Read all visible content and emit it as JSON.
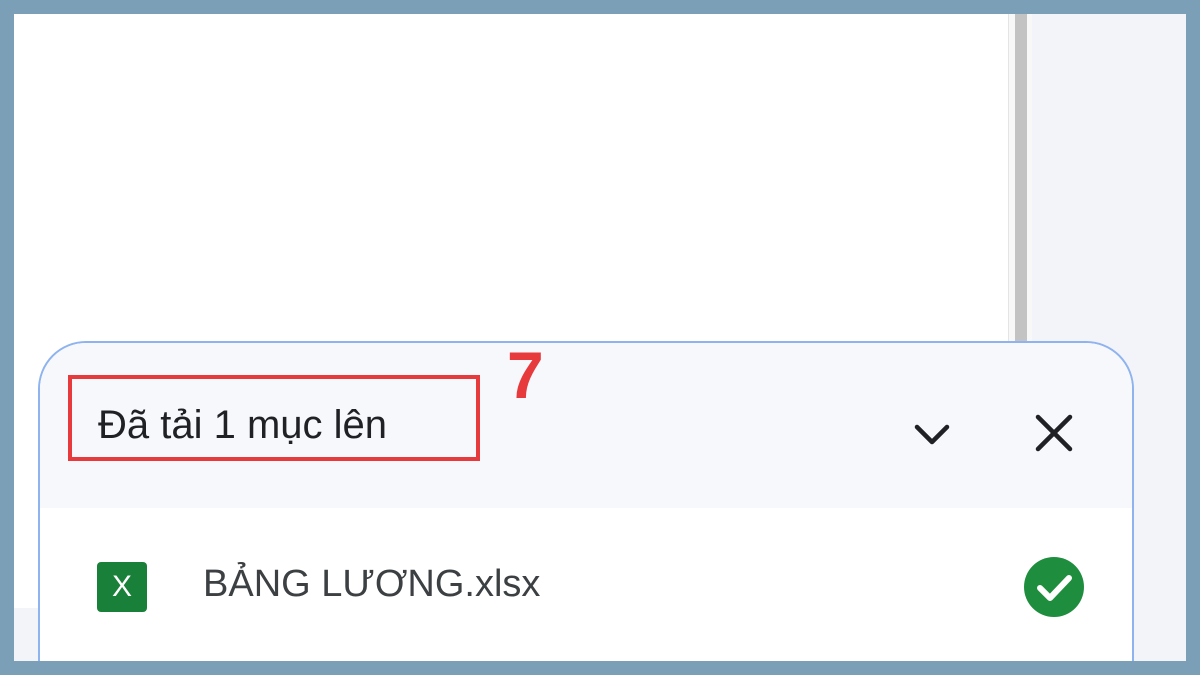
{
  "upload_panel": {
    "title": "Đã tải 1 mục lên",
    "collapse_icon": "chevron-down-icon",
    "close_icon": "close-icon"
  },
  "file_item": {
    "icon_letter": "X",
    "icon_color": "#188038",
    "name": "BẢNG LƯƠNG.xlsx",
    "status_icon": "check-circle-icon",
    "status_color": "#1e8e3e"
  },
  "annotation": {
    "step_number": "7",
    "color": "#e63a3d"
  }
}
